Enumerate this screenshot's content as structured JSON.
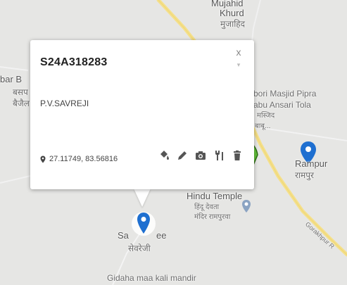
{
  "map": {
    "labels": {
      "mujahid_khurd": "Mujahid\nKhurd",
      "mujahid_khurd_hi": "मुजाहिद",
      "bar_b": "bar B",
      "basanp_hi": "बसप",
      "bajail_hi": "बैजैल",
      "masjid_pipra": "bori Masjid Pipra",
      "babu_ansari": "abu Ansari Tola",
      "masjid_hi": "मस्जिद",
      "babu_hi": "बाबू...",
      "rampur": "Rampur",
      "rampur_hi": "रामपुर",
      "hindu_temple": "Hindu Temple",
      "hindu_temple_hi1": "हिंदू देवता",
      "hindu_temple_hi2": "मंदिर रामपुरवा",
      "savreji_a": "Sa",
      "savreji_b": "ee",
      "savreji_hi": "सेवरेजी",
      "gidaha": "Gidaha maa kali mandir",
      "gorakhpur_road": "Gorakhpur R"
    },
    "colors": {
      "road": "#f5e08a",
      "pin": "#1e6fd0",
      "green": "#63c23a"
    }
  },
  "popup": {
    "title": "S24A318283",
    "subtitle": "P.V.SAVREJI",
    "coordinates": "27.11749, 83.56816",
    "close_label": "x",
    "tools": [
      "paint-bucket-icon",
      "pencil-icon",
      "camera-icon",
      "tools-icon",
      "trash-icon"
    ]
  }
}
